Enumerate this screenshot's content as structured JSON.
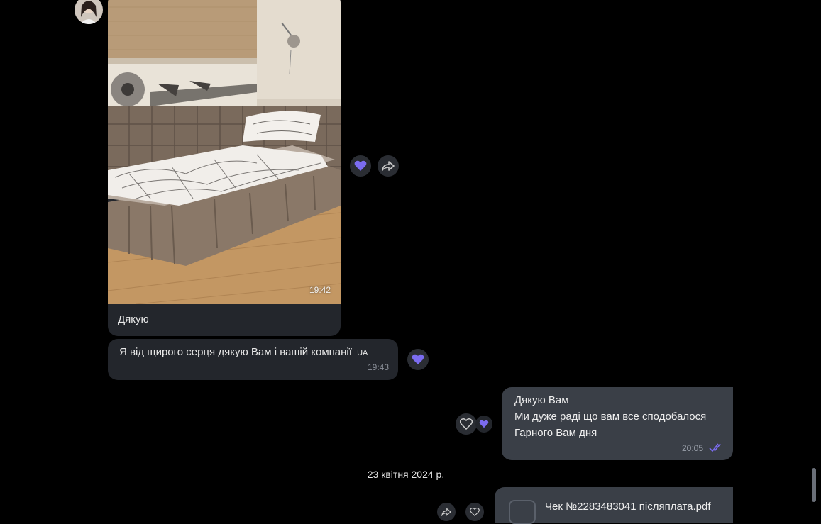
{
  "colors": {
    "background": "#000000",
    "incoming_bubble": "#23262c",
    "outgoing_bubble": "#3a3f47",
    "accent_purple": "#7b6cf0"
  },
  "messages": {
    "photo": {
      "time": "19:42",
      "caption": "Дякую"
    },
    "incoming_text": {
      "text": "Я від щирого серця дякую Вам і вашій компанії",
      "badge": "UA",
      "time": "19:43"
    },
    "outgoing": {
      "lines": [
        "Дякую Вам",
        "Ми дуже раді що вам все сподобалося",
        "Гарного Вам дня"
      ],
      "time": "20:05",
      "status": "read"
    },
    "date_separator": "23 квітня 2024 р.",
    "file": {
      "name": "Чек №2283483041 післяплата.pdf"
    }
  },
  "icons": {
    "reaction": "heart-icon",
    "forward": "forward-icon",
    "read_receipt": "double-check-icon",
    "file": "file-icon"
  }
}
